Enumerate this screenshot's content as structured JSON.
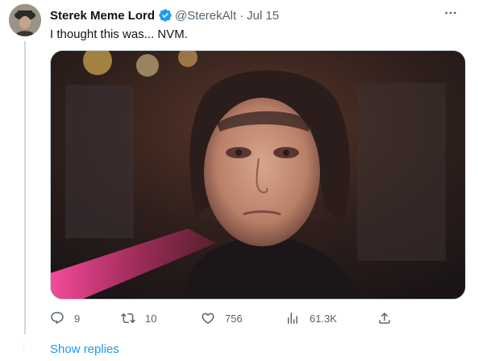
{
  "tweet": {
    "author_name": "Sterek Meme Lord",
    "handle": "@SterekAlt",
    "separator": "·",
    "date": "Jul 15",
    "text": "I thought this was... NVM.",
    "verified": true
  },
  "actions": {
    "replies": "9",
    "retweets": "10",
    "likes": "756",
    "views": "61.3K"
  },
  "show_replies": "Show replies",
  "icons": {
    "more": "more-icon",
    "reply": "reply-icon",
    "retweet": "retweet-icon",
    "like": "heart-icon",
    "views": "views-icon",
    "share": "share-icon",
    "verified": "verified-badge-icon"
  },
  "colors": {
    "accent": "#1d9bf0",
    "muted_text": "#536471",
    "text": "#0f1419"
  }
}
